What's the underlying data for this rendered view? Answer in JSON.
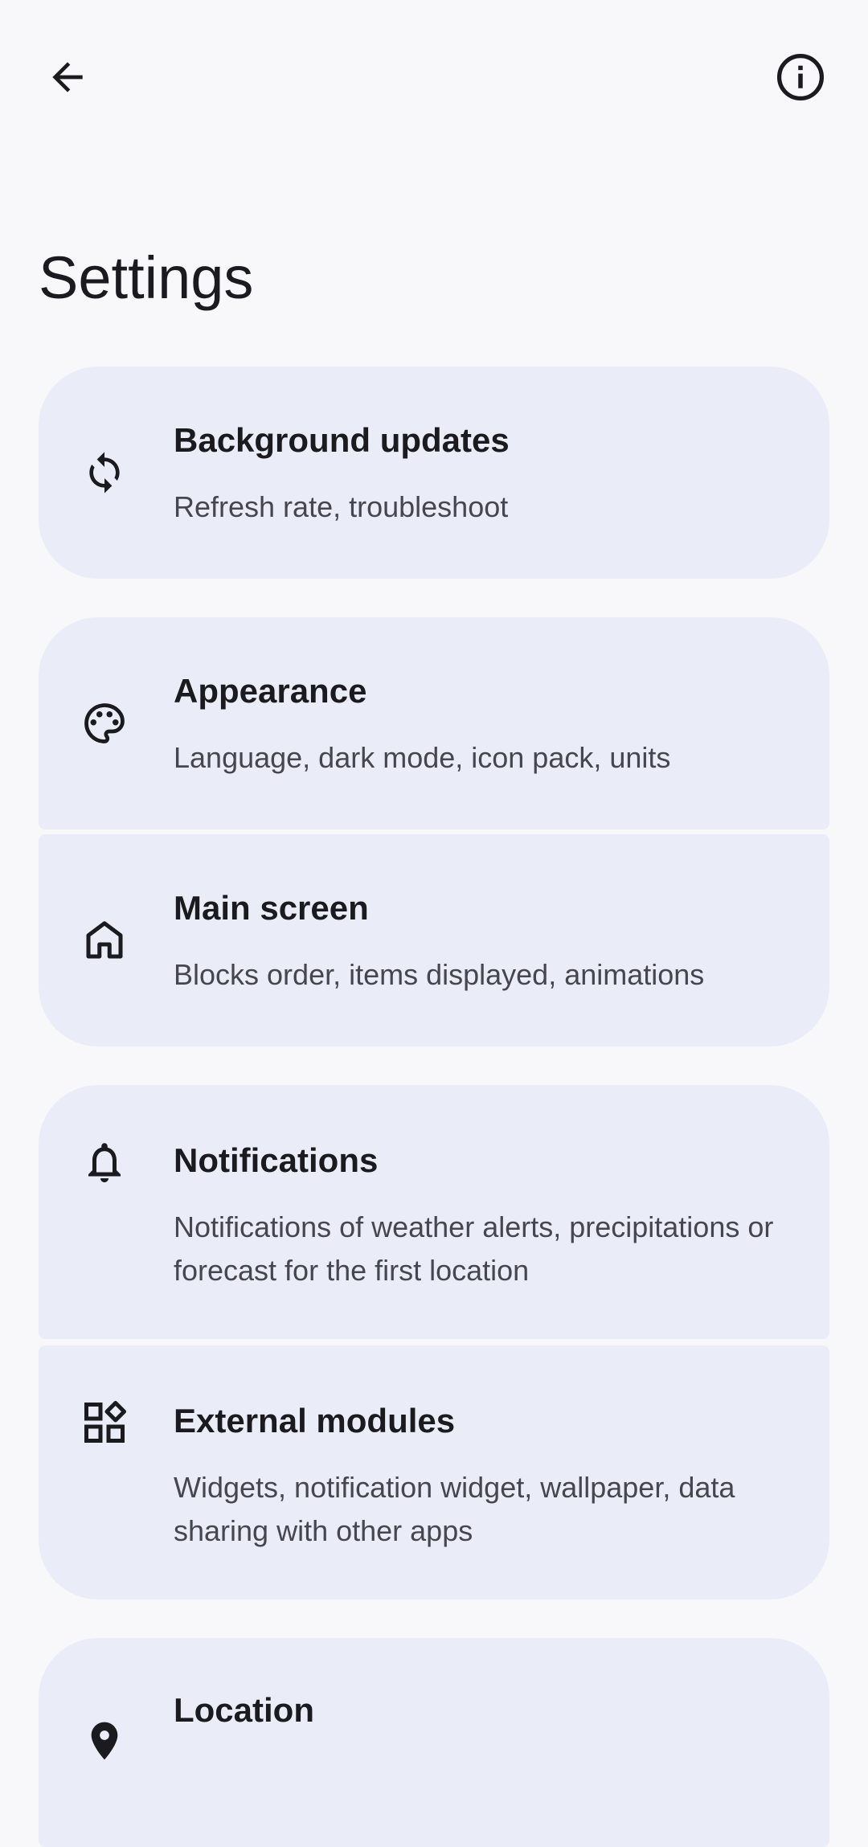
{
  "header": {
    "back_icon": "arrow-back-icon",
    "info_icon": "info-icon",
    "title": "Settings"
  },
  "settings": [
    {
      "icon": "sync-icon",
      "title": "Background updates",
      "subtitle": "Refresh rate, troubleshoot"
    },
    {
      "icon": "palette-icon",
      "title": "Appearance",
      "subtitle": "Language, dark mode, icon pack, units"
    },
    {
      "icon": "home-icon",
      "title": "Main screen",
      "subtitle": "Blocks order, items displayed, animations"
    },
    {
      "icon": "bell-icon",
      "title": "Notifications",
      "subtitle": "Notifications of weather alerts, precipitations or forecast for the first location"
    },
    {
      "icon": "widgets-icon",
      "title": "External modules",
      "subtitle": "Widgets, notification widget, wallpaper, data sharing with other apps"
    },
    {
      "icon": "location-pin-icon",
      "title": "Location",
      "subtitle": ""
    }
  ],
  "colors": {
    "background": "#f8f8fb",
    "card": "#eaedf8",
    "text_primary": "#1b1b1f",
    "text_secondary": "#45464f"
  }
}
